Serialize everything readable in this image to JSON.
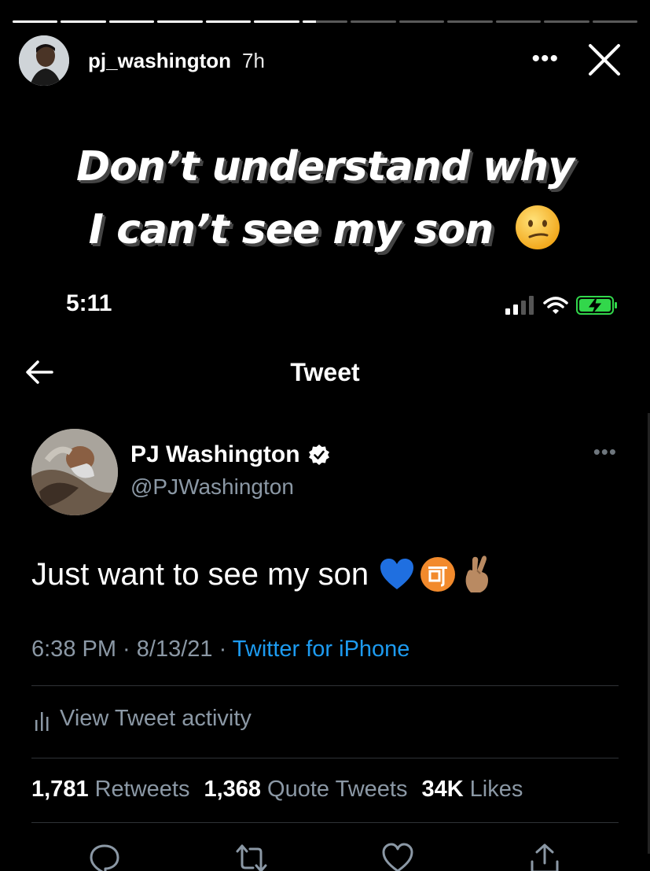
{
  "story": {
    "progress_segments": [
      1,
      1,
      1,
      1,
      1,
      1,
      0.3,
      0,
      0,
      0,
      0,
      0,
      0
    ],
    "username": "pj_washington",
    "time_ago": "7h",
    "more_label": "•••",
    "close_label": "close"
  },
  "caption": {
    "line1": "Don’t understand why",
    "line2": "I can’t see my son"
  },
  "phone": {
    "status_time": "5:11"
  },
  "tweet_page": {
    "title": "Tweet",
    "author_name": "PJ Washington",
    "author_handle": "@PJWashington",
    "more_label": "•••",
    "text": "Just want to see my son",
    "timestamp": "6:38 PM · 8/13/21 · ",
    "source": "Twitter for iPhone",
    "activity_label": "View Tweet activity",
    "stats": {
      "retweets_count": "1,781",
      "retweets_label": "Retweets",
      "quotes_count": "1,368",
      "quotes_label": "Quote Tweets",
      "likes_count": "34K",
      "likes_label": "Likes"
    }
  },
  "colors": {
    "background": "#000000",
    "secondary_text": "#8b98a5",
    "link_blue": "#1d9bf0",
    "verified": "#ffffff",
    "battery_green": "#32d74b"
  },
  "icons": [
    "back-arrow-icon",
    "verified-badge-icon",
    "blue-heart-icon",
    "accept-ideograph-icon",
    "crossed-fingers-icon",
    "bar-chart-icon",
    "reply-icon",
    "retweet-icon",
    "like-icon",
    "share-icon",
    "confused-face-icon",
    "signal-icon",
    "wifi-icon",
    "battery-charging-icon"
  ]
}
